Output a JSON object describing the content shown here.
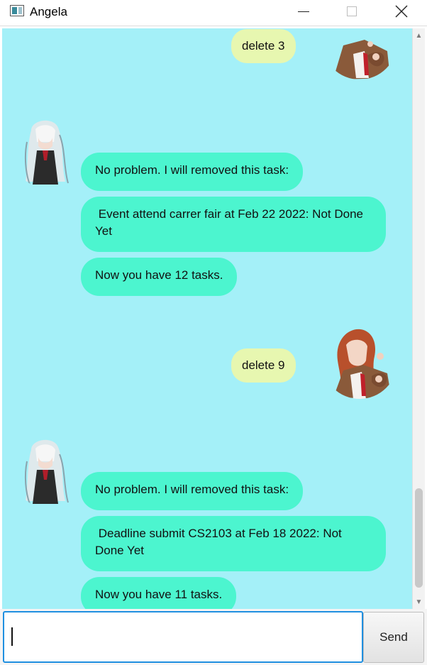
{
  "window": {
    "title": "Angela",
    "icons": {
      "app": "app-window-icon",
      "minimize": "minimize-icon",
      "maximize": "maximize-icon",
      "close": "close-icon"
    }
  },
  "chat": {
    "messages": [
      {
        "sender": "user",
        "text": "delete 3",
        "avatar": "user-avatar"
      },
      {
        "sender": "bot",
        "text": "No problem. I will removed this task:",
        "avatar": "bot-avatar"
      },
      {
        "sender": "bot",
        "text": " Event attend carrer fair at Feb 22 2022: Not Done Yet"
      },
      {
        "sender": "bot",
        "text": "Now you have 12 tasks."
      },
      {
        "sender": "user",
        "text": "delete 9",
        "avatar": "user-avatar"
      },
      {
        "sender": "bot",
        "text": "No problem. I will removed this task:",
        "avatar": "bot-avatar"
      },
      {
        "sender": "bot",
        "text": " Deadline submit CS2103 at Feb 18 2022: Not Done Yet"
      },
      {
        "sender": "bot",
        "text": "Now you have 11 tasks."
      }
    ]
  },
  "input": {
    "value": "",
    "placeholder": ""
  },
  "send_button": {
    "label": "Send"
  },
  "colors": {
    "chat_background": "#a4f0f8",
    "user_bubble": "#e7f7b0",
    "bot_bubble": "#4cf5cf",
    "input_focus": "#1f8fe0"
  }
}
